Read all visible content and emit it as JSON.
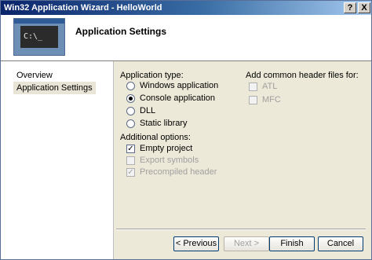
{
  "window": {
    "title": "Win32 Application Wizard - HelloWorld"
  },
  "titlebar": {
    "help_label": "?",
    "close_label": "X"
  },
  "header": {
    "prompt_text": "C:\\_",
    "title": "Application Settings"
  },
  "nav": {
    "items": [
      {
        "label": "Overview"
      },
      {
        "label": "Application Settings",
        "selected": true
      }
    ]
  },
  "application_type": {
    "label": "Application type:",
    "options": [
      {
        "label": "Windows application",
        "checked": false
      },
      {
        "label": "Console application",
        "checked": true
      },
      {
        "label": "DLL",
        "checked": false
      },
      {
        "label": "Static library",
        "checked": false
      }
    ]
  },
  "additional_options": {
    "label": "Additional options:",
    "options": [
      {
        "label": "Empty project",
        "checked": true,
        "enabled": true
      },
      {
        "label": "Export symbols",
        "checked": false,
        "enabled": false
      },
      {
        "label": "Precompiled header",
        "checked": true,
        "enabled": false
      }
    ]
  },
  "common_headers": {
    "label": "Add common header files for:",
    "options": [
      {
        "label": "ATL",
        "checked": false,
        "enabled": false
      },
      {
        "label": "MFC",
        "checked": false,
        "enabled": false
      }
    ]
  },
  "buttons": {
    "previous": "< Previous",
    "next": "Next >",
    "finish": "Finish",
    "cancel": "Cancel"
  },
  "colors": {
    "title_gradient_start": "#0a246a",
    "title_gradient_end": "#a6caf0",
    "dialog_bg": "#ece9d8"
  }
}
